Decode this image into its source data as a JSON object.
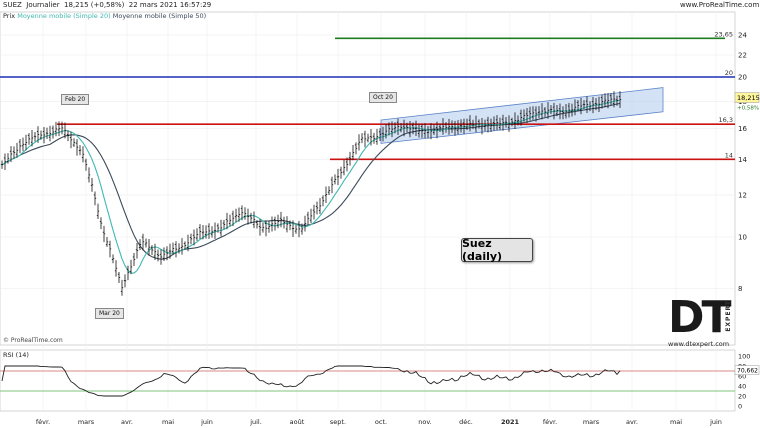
{
  "header": {
    "symbol": "SUEZ",
    "timeframe": "Journalier",
    "last": "18,215 (+0,58%)",
    "datetime": "22 mars 2021 16:57:29",
    "site": "www.ProRealTime.com"
  },
  "legend": {
    "price": "Prix",
    "ma20": "Moyenne mobile (Simple 20)",
    "ma50": "Moyenne mobile (Simple 50)"
  },
  "copyright": "© ProRealTime.com",
  "title_box": "Suez (daily)",
  "logo": {
    "main": "DT",
    "sub": "EXPERT",
    "url": "www.dtexpert.com"
  },
  "price_badge": {
    "value": "18,215",
    "change": "+0,58%"
  },
  "rsi": {
    "label": "RSI (14)",
    "value_badge": "70,662"
  },
  "colors": {
    "candle": "#111111",
    "ma20": "#3fb8b0",
    "ma50": "#3b4a5a",
    "green": "#1e7d1e",
    "blue": "#1b2fb8",
    "red": "#cc1111",
    "channel": "#a9c6ee",
    "rsi_line": "#222222",
    "rsi_over": "#d98a8a",
    "rsi_under": "#7bc47b"
  },
  "annotations": [
    {
      "id": "feb20",
      "text": "Feb 20"
    },
    {
      "id": "mar20",
      "text": "Mar 20"
    },
    {
      "id": "oct20",
      "text": "Oct 20"
    }
  ],
  "chart_data": {
    "type": "candlestick",
    "title": "Suez (daily)",
    "price_axis": {
      "scale": "log",
      "ticks": [
        8,
        10,
        12,
        14,
        16,
        18,
        20,
        22,
        24
      ]
    },
    "rsi_axis": {
      "ticks": [
        0,
        20,
        40,
        60,
        80,
        100
      ],
      "levels": [
        30,
        70
      ]
    },
    "x_ticks": [
      "févr.",
      "mars",
      "avr.",
      "mai",
      "juin",
      "juil.",
      "août",
      "sept.",
      "oct.",
      "nov.",
      "déc.",
      "2021",
      "févr.",
      "mars",
      "avr.",
      "mai",
      "juin"
    ],
    "horizontal_levels": [
      {
        "name": "23,65",
        "value": 23.65,
        "color": "green"
      },
      {
        "name": "20",
        "value": 20,
        "color": "blue"
      },
      {
        "name": "16,3",
        "value": 16.3,
        "color": "red"
      },
      {
        "name": "14",
        "value": 14,
        "color": "red"
      }
    ],
    "channel": {
      "start": [
        "oct.",
        15.0,
        16.6
      ],
      "end": [
        "avr.",
        17.2,
        19.1
      ]
    },
    "close_path": [
      [
        "janv.",
        13.6
      ],
      [
        "févr.",
        15.0
      ],
      [
        "févr.",
        15.6
      ],
      [
        "mars",
        16.0
      ],
      [
        "mars",
        14.5
      ],
      [
        "mars",
        10.5
      ],
      [
        "mars",
        8.0
      ],
      [
        "avr.",
        9.8
      ],
      [
        "avr.",
        9.2
      ],
      [
        "mai",
        9.6
      ],
      [
        "mai",
        10.2
      ],
      [
        "juin",
        10.4
      ],
      [
        "juin",
        11.2
      ],
      [
        "juil.",
        10.4
      ],
      [
        "juil.",
        10.7
      ],
      [
        "août",
        10.3
      ],
      [
        "août",
        11.6
      ],
      [
        "sept.",
        13.2
      ],
      [
        "sept.",
        15.2
      ],
      [
        "oct.",
        15.6
      ],
      [
        "oct.",
        16.2
      ],
      [
        "nov.",
        15.8
      ],
      [
        "nov.",
        16.0
      ],
      [
        "déc.",
        16.2
      ],
      [
        "déc.",
        16.3
      ],
      [
        "2021",
        16.3
      ],
      [
        "2021",
        16.7
      ],
      [
        "févr.",
        17.3
      ],
      [
        "févr.",
        17.2
      ],
      [
        "mars",
        17.6
      ],
      [
        "mars",
        17.9
      ],
      [
        "mars",
        18.215
      ]
    ],
    "last_close": 18.215,
    "last_change": "+0,58%",
    "rsi_last": 70.662
  }
}
